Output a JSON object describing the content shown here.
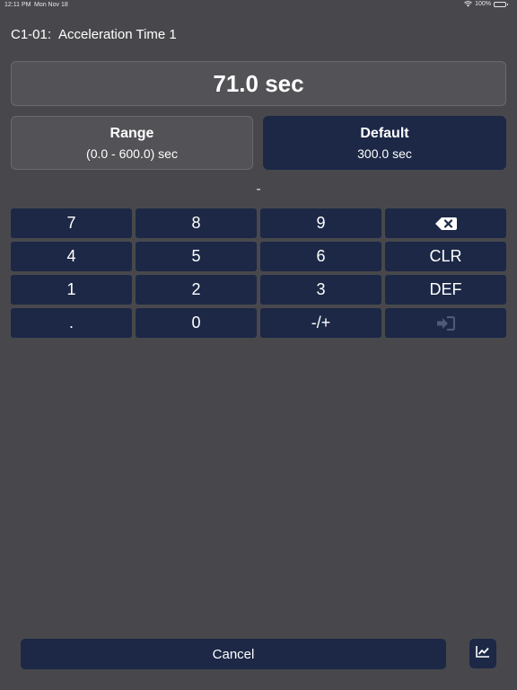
{
  "status_bar": {
    "time": "12:11 PM",
    "date": "Mon Nov 18",
    "battery": "100%"
  },
  "header": {
    "param_code": "C1-01:",
    "param_name": "Acceleration Time 1"
  },
  "value_display": {
    "value": "71.0 sec"
  },
  "range": {
    "title": "Range",
    "value": "(0.0 - 600.0) sec"
  },
  "default": {
    "title": "Default",
    "value": "300.0 sec"
  },
  "entry_indicator": "-",
  "keypad": {
    "k7": "7",
    "k8": "8",
    "k9": "9",
    "backspace_icon": "backspace-icon",
    "k4": "4",
    "k5": "5",
    "k6": "6",
    "clr": "CLR",
    "k1": "1",
    "k2": "2",
    "k3": "3",
    "def": "DEF",
    "dot": ".",
    "k0": "0",
    "sign": "-/+",
    "enter_icon": "sign-in-icon"
  },
  "footer": {
    "cancel_label": "Cancel",
    "chart_icon": "chart-icon"
  },
  "colors": {
    "background": "#48484c",
    "panel": "#535357",
    "accent_navy": "#1c2846",
    "disabled_icon": "#4d5a78"
  }
}
